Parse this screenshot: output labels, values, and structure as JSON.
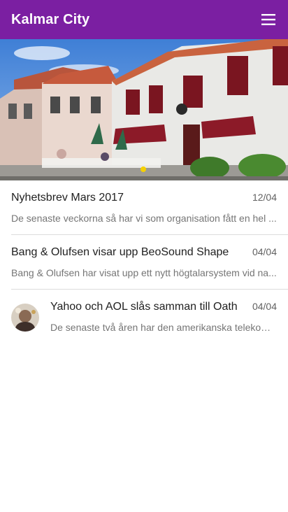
{
  "app": {
    "title": "Kalmar City",
    "colors": {
      "primary": "#7b1fa2"
    },
    "menu_icon": "menu-icon"
  },
  "news": [
    {
      "title": "Nyhetsbrev Mars 2017",
      "date": "12/04",
      "snippet": "De senaste veckorna så har vi som organisation fått en hel ..."
    },
    {
      "title": "Bang & Olufsen visar upp BeoSound Shape",
      "date": "04/04",
      "snippet": "Bang & Olufsen har visat upp ett nytt högtalarsystem vid na..."
    },
    {
      "title": "Yahoo och AOL slås samman till Oath",
      "date": "04/04",
      "snippet": "De senaste två åren har den amerikanska telekomj..."
    }
  ]
}
